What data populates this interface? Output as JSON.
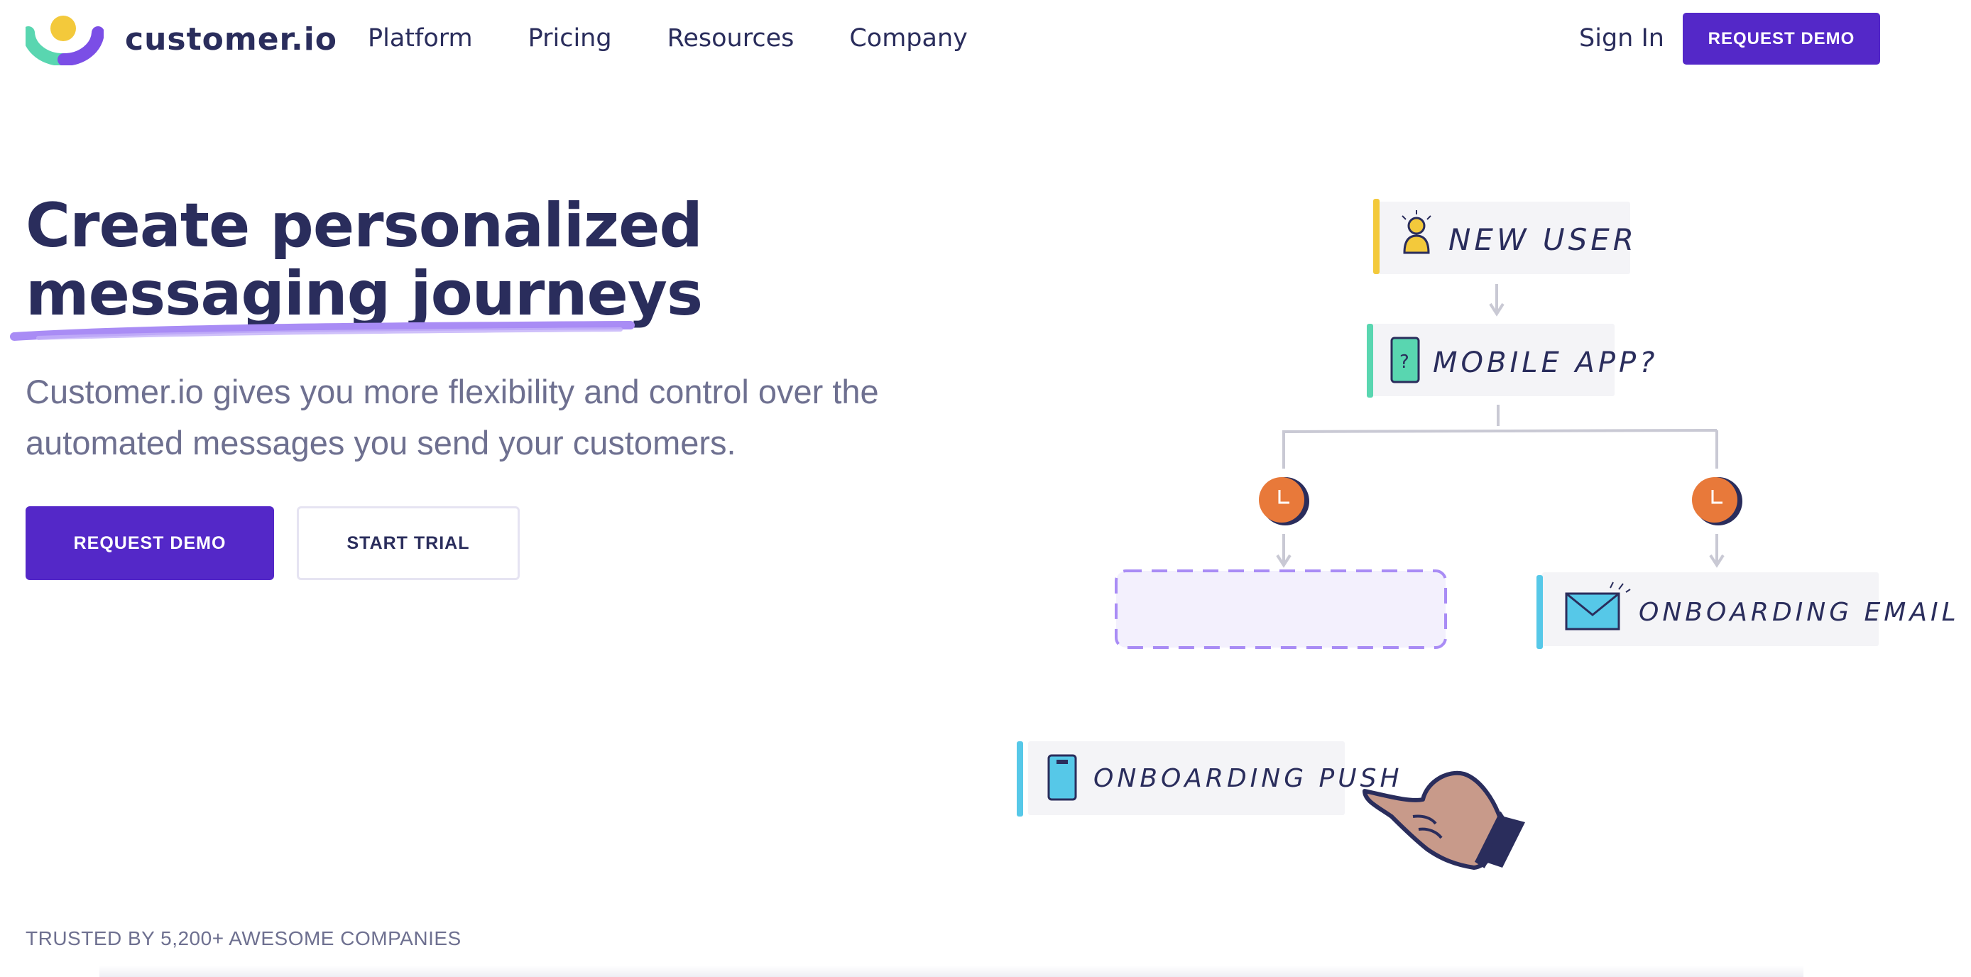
{
  "brand": {
    "name": "customer.io"
  },
  "nav": {
    "items": [
      {
        "label": "Platform"
      },
      {
        "label": "Pricing"
      },
      {
        "label": "Resources"
      },
      {
        "label": "Company"
      }
    ],
    "sign_in": "Sign In",
    "request_demo": "REQUEST DEMO"
  },
  "hero": {
    "headline_line1": "Create personalized",
    "headline_line2": "messaging journeys",
    "subhead": "Customer.io gives you more flexibility and control over the automated messages you send your customers.",
    "primary_cta": "REQUEST DEMO",
    "secondary_cta": "START TRIAL"
  },
  "workflow": {
    "nodes": {
      "new_user": "NEW USER",
      "mobile_app": "MOBILE APP?",
      "onboarding_email": "ONBOARDING EMAIL",
      "onboarding_push": "ONBOARDING PUSH"
    },
    "icons": {
      "new_user": "person-icon",
      "mobile_app": "phone-question-icon",
      "onboarding_email": "envelope-icon",
      "onboarding_push": "phone-icon",
      "delay": "clock-icon",
      "pointer": "pointing-hand-icon"
    }
  },
  "trusted": "TRUSTED BY 5,200+ AWESOME COMPANIES",
  "colors": {
    "brand_purple": "#5428c8",
    "navy": "#2a2d5c",
    "muted_text": "#6e7090",
    "highlight_purple": "#a98cf5",
    "yellow": "#f3c93b",
    "teal": "#59d6b0",
    "cyan": "#56c8e8",
    "orange": "#e8793a"
  }
}
